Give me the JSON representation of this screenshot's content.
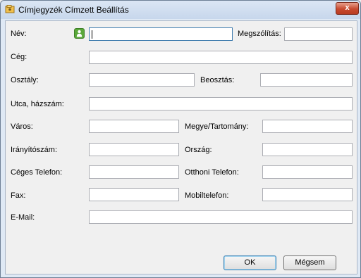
{
  "window": {
    "title": "Címjegyzék Címzett Beállítás",
    "close_glyph": "x"
  },
  "form": {
    "name_label": "Név:",
    "name_value": "",
    "salutation_label": "Megszólítás:",
    "salutation_value": "",
    "company_label": "Cég:",
    "company_value": "",
    "department_label": "Osztály:",
    "department_value": "",
    "position_label": "Beosztás:",
    "position_value": "",
    "street_label": "Utca, házszám:",
    "street_value": "",
    "city_label": "Város:",
    "city_value": "",
    "county_label": "Megye/Tartomány:",
    "county_value": "",
    "zip_label": "Irányítószám:",
    "zip_value": "",
    "country_label": "Ország:",
    "country_value": "",
    "work_phone_label": "Céges Telefon:",
    "work_phone_value": "",
    "home_phone_label": "Otthoni Telefon:",
    "home_phone_value": "",
    "fax_label": "Fax:",
    "fax_value": "",
    "mobile_label": "Mobiltelefon:",
    "mobile_value": "",
    "email_label": "E-Mail:",
    "email_value": ""
  },
  "buttons": {
    "ok_label": "OK",
    "cancel_label": "Mégsem"
  },
  "icons": {
    "app": "address-book-icon",
    "user": "contact-picker-icon",
    "close": "close-icon"
  },
  "colors": {
    "titlebar": "#c7d7ec",
    "close_button": "#c74a2f",
    "contact_icon": "#5aa83a",
    "focus_border": "#3d7bad"
  }
}
